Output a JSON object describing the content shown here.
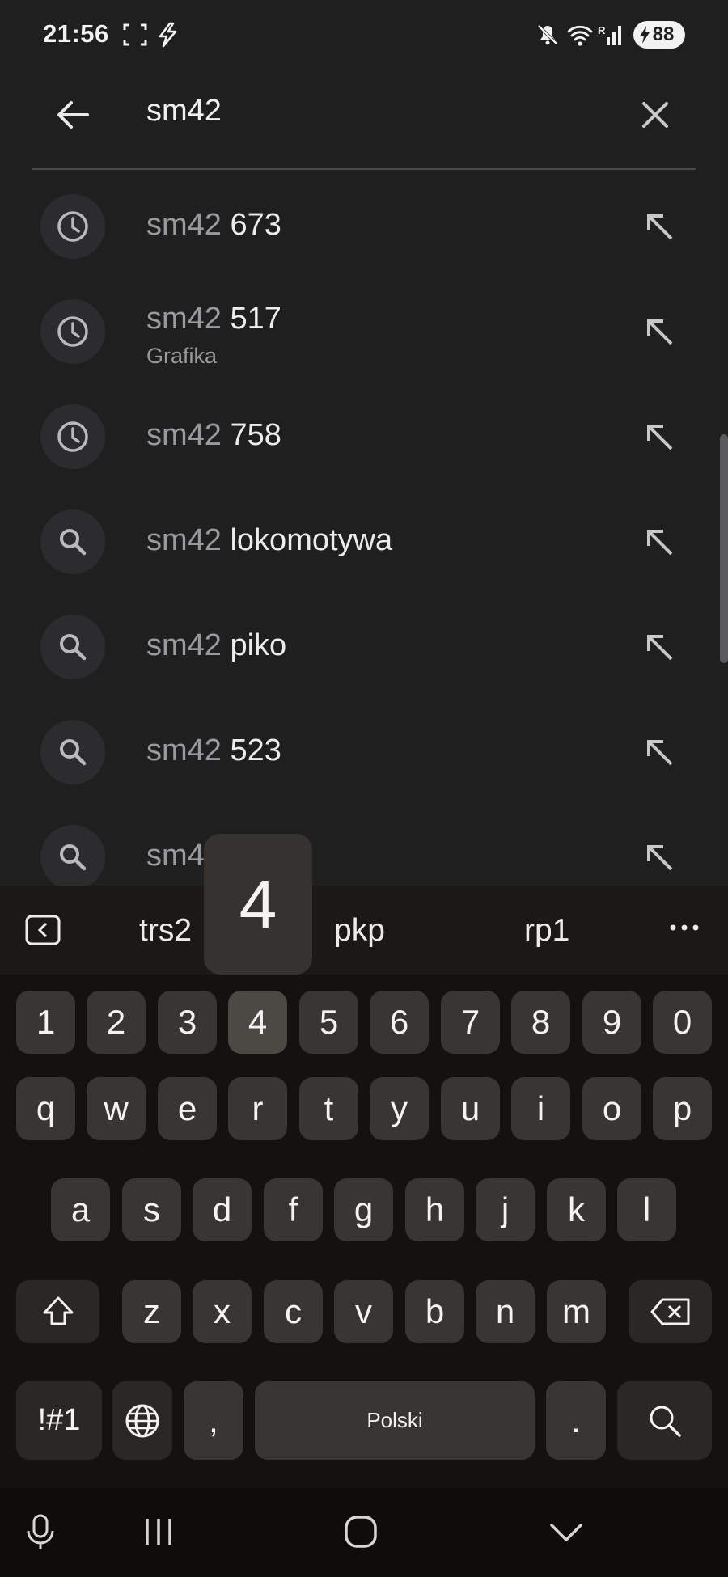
{
  "status_bar": {
    "time": "21:56",
    "battery": "88",
    "icons": [
      "screenshot-frame-icon",
      "charging-bolt-icon",
      "mute-icon",
      "wifi-icon",
      "signal-icon",
      "battery-icon"
    ]
  },
  "search": {
    "query": "sm42",
    "back_icon": "arrow-back-icon",
    "clear_icon": "close-icon"
  },
  "suggestions": [
    {
      "type": "history",
      "icon": "history-icon",
      "prefix": "sm42",
      "suffix": " 673",
      "subtitle": ""
    },
    {
      "type": "history",
      "icon": "history-icon",
      "prefix": "sm42",
      "suffix": " 517",
      "subtitle": "Grafika"
    },
    {
      "type": "history",
      "icon": "history-icon",
      "prefix": "sm42",
      "suffix": " 758",
      "subtitle": ""
    },
    {
      "type": "search",
      "icon": "search-icon",
      "prefix": "sm42",
      "suffix": " lokomotywa",
      "subtitle": ""
    },
    {
      "type": "search",
      "icon": "search-icon",
      "prefix": "sm42",
      "suffix": " piko",
      "subtitle": ""
    },
    {
      "type": "search",
      "icon": "search-icon",
      "prefix": "sm42",
      "suffix": " 523",
      "subtitle": ""
    },
    {
      "type": "search",
      "icon": "search-icon",
      "prefix": "sm4",
      "suffix": "",
      "subtitle": ""
    }
  ],
  "keyboard": {
    "suggestions": [
      "trs2",
      "pkp",
      "rp1"
    ],
    "popup_key": "4",
    "number_row": [
      "1",
      "2",
      "3",
      "4",
      "5",
      "6",
      "7",
      "8",
      "9",
      "0"
    ],
    "row_q": [
      "q",
      "w",
      "e",
      "r",
      "t",
      "y",
      "u",
      "i",
      "o",
      "p"
    ],
    "row_a": [
      "a",
      "s",
      "d",
      "f",
      "g",
      "h",
      "j",
      "k",
      "l"
    ],
    "row_z": [
      "z",
      "x",
      "c",
      "v",
      "b",
      "n",
      "m"
    ],
    "symbols_label": "!#1",
    "comma_label": ",",
    "space_label": "Polski",
    "period_label": ".",
    "pressed_key": "4"
  },
  "navbar": {
    "icons": [
      "microphone-icon",
      "recent-apps-icon",
      "home-icon",
      "hide-keyboard-icon"
    ]
  }
}
